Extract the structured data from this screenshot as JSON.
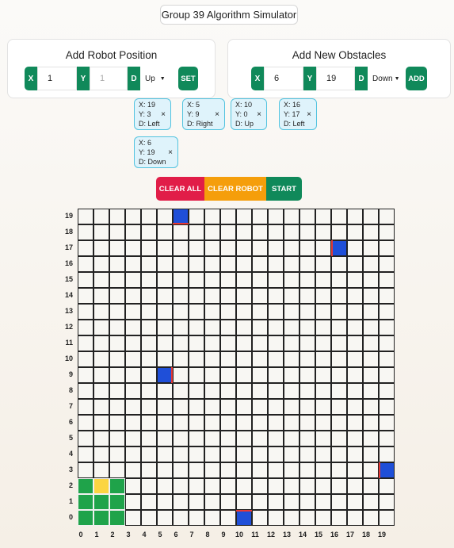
{
  "title": "Group 39 Algorithm Simulator",
  "robot_panel": {
    "heading": "Add Robot Position",
    "x_label": "X",
    "x_value": "1",
    "y_label": "Y",
    "y_placeholder": "1",
    "d_label": "D",
    "d_value": "Up",
    "button": "SET"
  },
  "obstacle_panel": {
    "heading": "Add New Obstacles",
    "x_label": "X",
    "x_value": "6",
    "y_label": "Y",
    "y_value": "19",
    "d_label": "D",
    "d_value": "Down",
    "button": "ADD"
  },
  "obstacles": [
    {
      "x": "X: 19",
      "y": "Y: 3",
      "d": "D: Left",
      "remove": "×"
    },
    {
      "x": "X: 5",
      "y": "Y: 9",
      "d": "D: Right",
      "remove": "×"
    },
    {
      "x": "X: 10",
      "y": "Y: 0",
      "d": "D: Up",
      "remove": "×"
    },
    {
      "x": "X: 16",
      "y": "Y: 17",
      "d": "D: Left",
      "remove": "×"
    },
    {
      "x": "X: 6",
      "y": "Y: 19",
      "d": "D: Down",
      "remove": "×"
    }
  ],
  "grid_obstacles": [
    {
      "x": 19,
      "y": 3,
      "face": "left"
    },
    {
      "x": 5,
      "y": 9,
      "face": "right"
    },
    {
      "x": 10,
      "y": 0,
      "face": "up"
    },
    {
      "x": 16,
      "y": 17,
      "face": "left"
    },
    {
      "x": 6,
      "y": 19,
      "face": "down"
    }
  ],
  "robot": {
    "x": 1,
    "y": 1,
    "direction": "up"
  },
  "controls": {
    "clear_all": "CLEAR ALL",
    "clear_robot": "CLEAR ROBOT",
    "start": "START"
  },
  "colors": {
    "green": "#10895a",
    "clear_all": "#e11d48",
    "clear_robot": "#f59e0b",
    "obstacle": "#1f4fd8",
    "obstacle_face": "#e53935",
    "robot_body": "#1fa34a",
    "robot_head": "#fbd542"
  },
  "grid": {
    "size": 20,
    "x_labels": [
      "0",
      "1",
      "2",
      "3",
      "4",
      "5",
      "6",
      "7",
      "8",
      "9",
      "10",
      "11",
      "12",
      "13",
      "14",
      "15",
      "16",
      "17",
      "18",
      "19"
    ],
    "y_labels": [
      "0",
      "1",
      "2",
      "3",
      "4",
      "5",
      "6",
      "7",
      "8",
      "9",
      "10",
      "11",
      "12",
      "13",
      "14",
      "15",
      "16",
      "17",
      "18",
      "19"
    ]
  }
}
